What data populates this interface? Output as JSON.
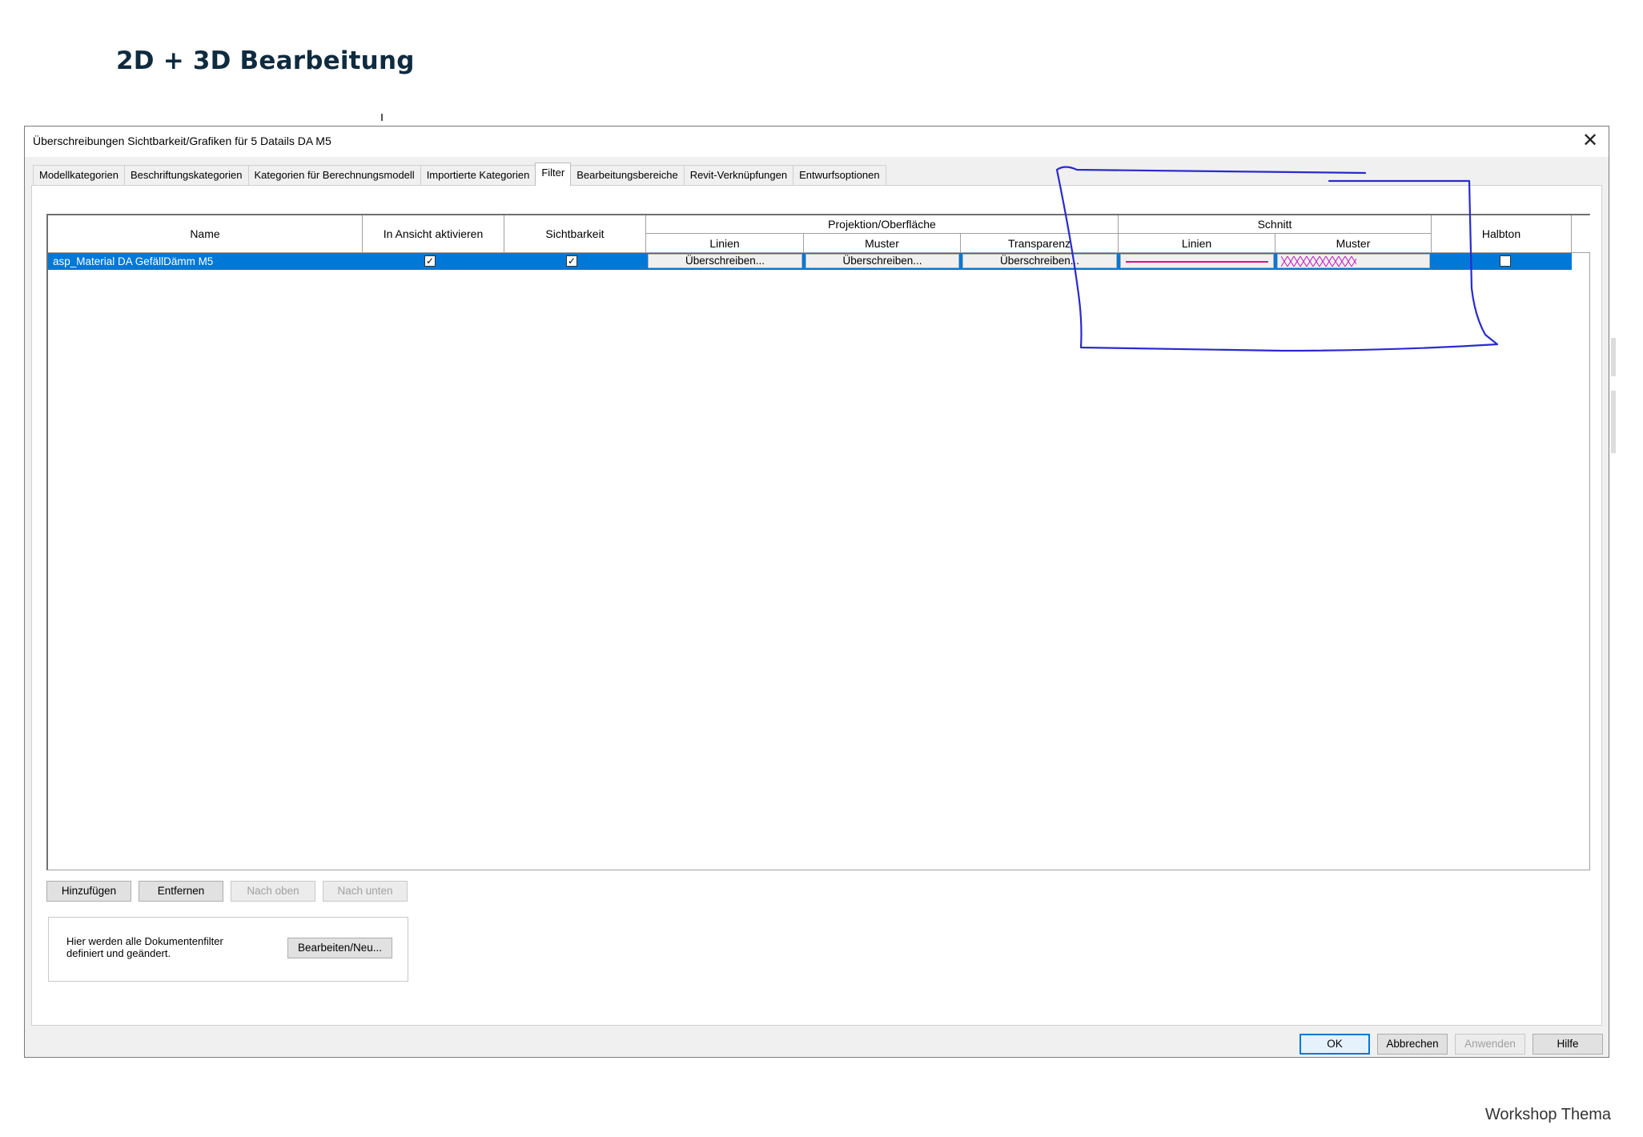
{
  "slide": {
    "title": "2D + 3D Bearbeitung",
    "footer": "Workshop Thema"
  },
  "dialog": {
    "title": "Überschreibungen Sichtbarkeit/Grafiken für 5 Datails DA M5",
    "close_symbol": "✕",
    "tabs": [
      "Modellkategorien",
      "Beschriftungskategorien",
      "Kategorien für Berechnungsmodell",
      "Importierte Kategorien",
      "Filter",
      "Bearbeitungsbereiche",
      "Revit-Verknüpfungen",
      "Entwurfsoptionen"
    ],
    "active_tab": "Filter"
  },
  "table": {
    "headers": {
      "name": "Name",
      "enable": "In Ansicht aktivieren",
      "visibility": "Sichtbarkeit",
      "projection": "Projektion/Oberfläche",
      "proj_lines": "Linien",
      "proj_pattern": "Muster",
      "proj_transparency": "Transparenz",
      "cut": "Schnitt",
      "cut_lines": "Linien",
      "cut_pattern": "Muster",
      "halftone": "Halbton"
    },
    "rows": [
      {
        "name": "asp_Material DA GefällDämm M5",
        "enable_checked": true,
        "visibility_checked": true,
        "proj_lines": "Überschreiben...",
        "proj_pattern": "Überschreiben...",
        "proj_transparency": "Überschreiben...",
        "cut_line_color": "#e0117f",
        "cut_pattern_color": "#c020c0",
        "halftone_checked": false
      }
    ],
    "check_symbol": "✓"
  },
  "buttons": {
    "add": "Hinzufügen",
    "remove": "Entfernen",
    "up": "Nach oben",
    "down": "Nach unten",
    "edit_new": "Bearbeiten/Neu...",
    "ok": "OK",
    "cancel": "Abbrechen",
    "apply": "Anwenden",
    "help": "Hilfe"
  },
  "info": {
    "text": "Hier werden alle Dokumentenfilter definiert und geändert."
  },
  "colors": {
    "selection": "#0078d7",
    "annotation": "#2a2ad0",
    "title": "#0f2b3f"
  }
}
